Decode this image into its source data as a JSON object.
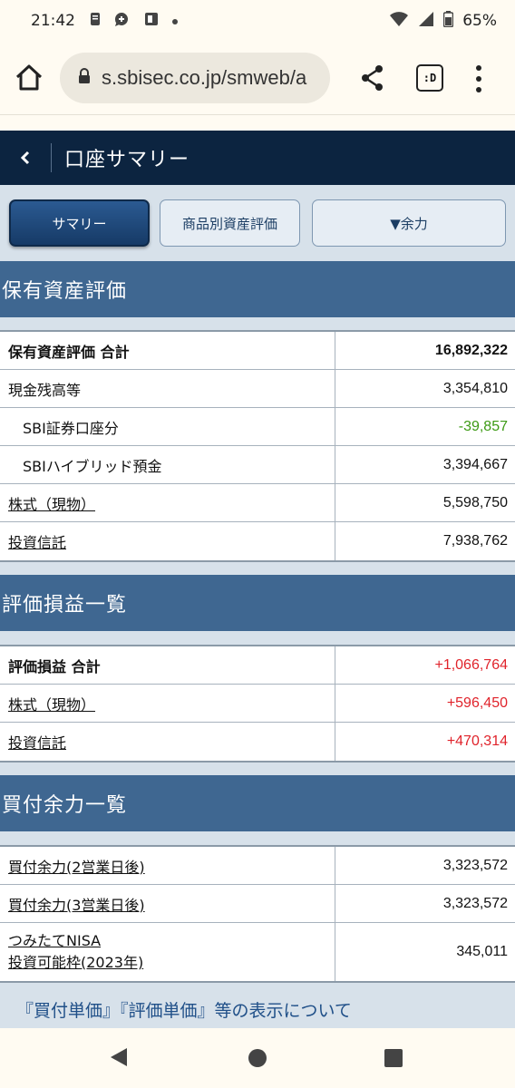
{
  "status": {
    "time": "21:42",
    "battery": "65%"
  },
  "browser": {
    "url": "s.sbisec.co.jp/smweb/a",
    "tab_icon_text": ":D"
  },
  "header": {
    "title": "口座サマリー"
  },
  "tabs": {
    "summary": "サマリー",
    "asset_eval": "商品別資産評価",
    "power": "▼余力"
  },
  "sections": {
    "holdings": {
      "title": "保有資産評価",
      "rows": [
        {
          "label": "保有資産評価 合計",
          "value": "16,892,322"
        },
        {
          "label": "現金残高等",
          "value": "3,354,810"
        },
        {
          "label": "SBI証券口座分",
          "value": "-39,857"
        },
        {
          "label": "SBIハイブリッド預金",
          "value": "3,394,667"
        },
        {
          "label": "株式（現物）",
          "value": "5,598,750"
        },
        {
          "label": "投資信託",
          "value": "7,938,762"
        }
      ]
    },
    "pnl": {
      "title": "評価損益一覧",
      "rows": [
        {
          "label": "評価損益 合計",
          "value": "+1,066,764"
        },
        {
          "label": "株式（現物）",
          "value": "+596,450"
        },
        {
          "label": "投資信託",
          "value": "+470,314"
        }
      ]
    },
    "buying_power": {
      "title": "買付余力一覧",
      "rows": [
        {
          "label": "買付余力(2営業日後)",
          "value": "3,323,572"
        },
        {
          "label": "買付余力(3営業日後)",
          "value": "3,323,572"
        },
        {
          "label_line1": "つみたてNISA",
          "label_line2": "投資可能枠(2023年)",
          "value": "345,011"
        }
      ]
    }
  },
  "footer_link": "『買付単価』『評価単価』等の表示について",
  "colors": {
    "header_bg": "#0c2440",
    "section_bg": "#3f6791",
    "positive": "#e0232b",
    "negative": "#3c9a14"
  }
}
